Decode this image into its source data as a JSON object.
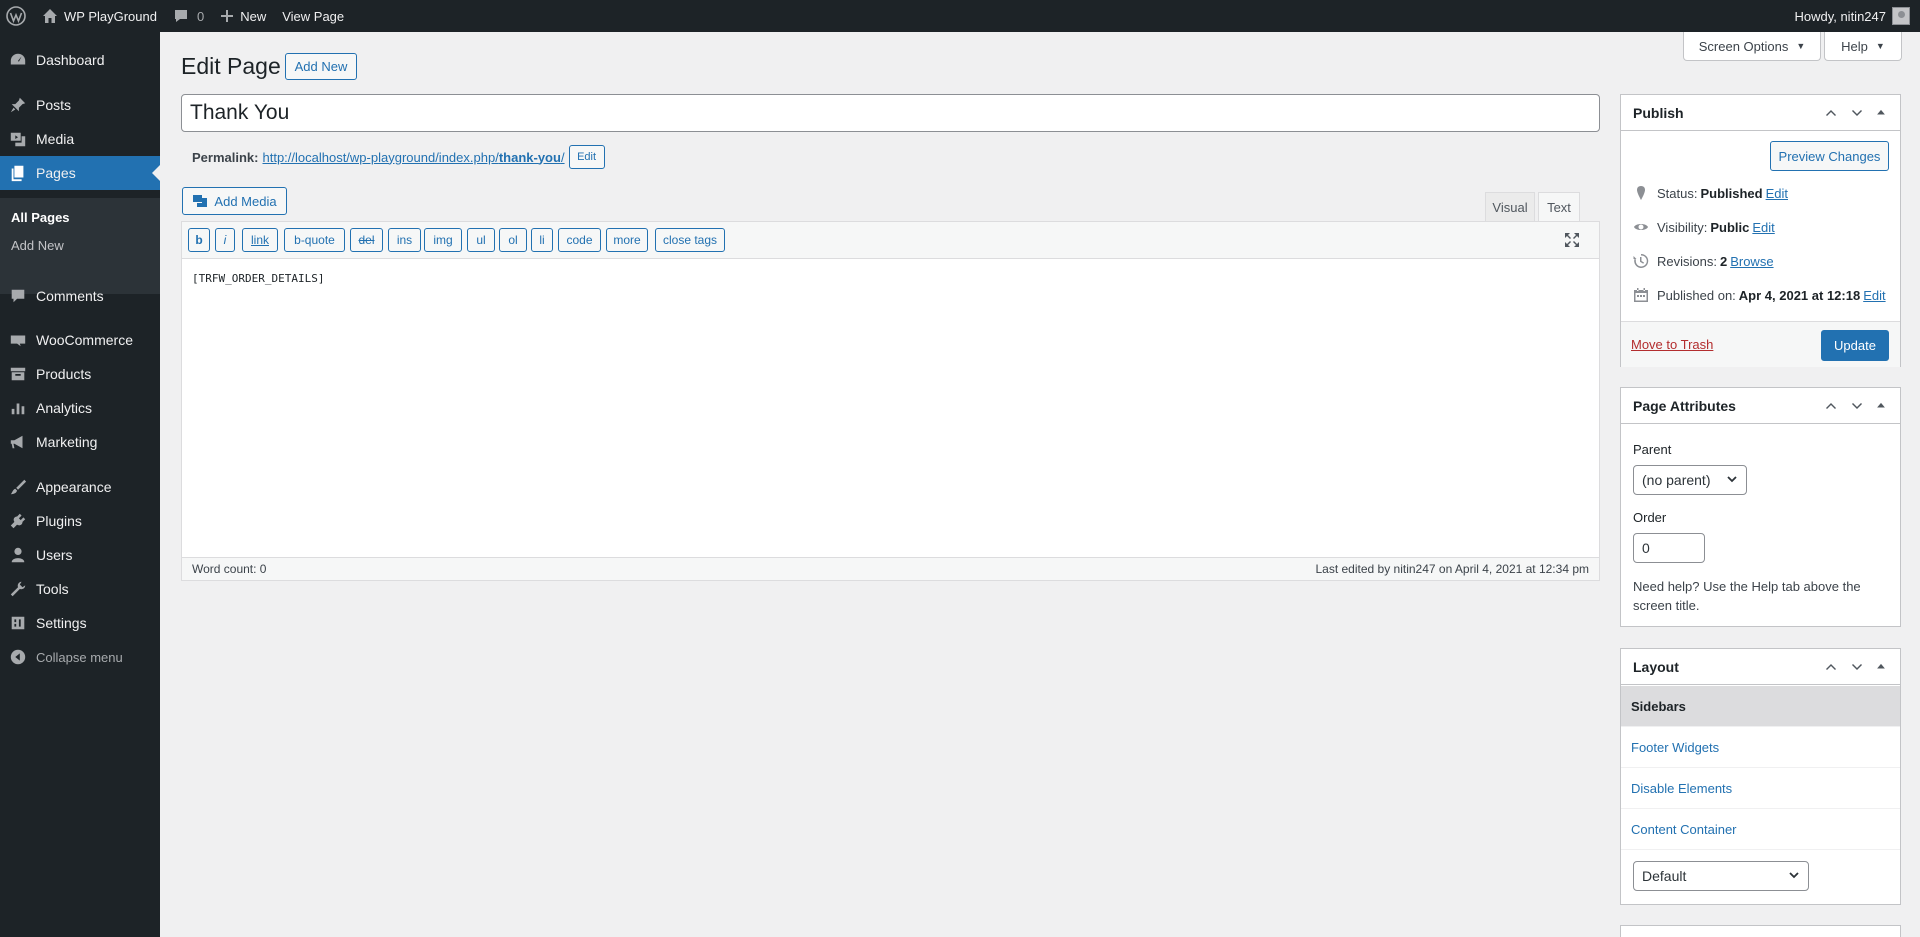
{
  "adminbar": {
    "site_name": "WP PlayGround",
    "comments_count": "0",
    "new_label": "New",
    "view_page": "View Page",
    "howdy": "Howdy, nitin247"
  },
  "sidebar": {
    "items": [
      {
        "label": "Dashboard",
        "icon": "dashboard-icon"
      },
      {
        "label": "Posts",
        "icon": "pin-icon"
      },
      {
        "label": "Media",
        "icon": "media-icon"
      },
      {
        "label": "Pages",
        "icon": "pages-icon"
      },
      {
        "label": "Comments",
        "icon": "comment-icon"
      },
      {
        "label": "WooCommerce",
        "icon": "woo-icon"
      },
      {
        "label": "Products",
        "icon": "archive-icon"
      },
      {
        "label": "Analytics",
        "icon": "chart-icon"
      },
      {
        "label": "Marketing",
        "icon": "megaphone-icon"
      },
      {
        "label": "Appearance",
        "icon": "brush-icon"
      },
      {
        "label": "Plugins",
        "icon": "plug-icon"
      },
      {
        "label": "Users",
        "icon": "user-icon"
      },
      {
        "label": "Tools",
        "icon": "wrench-icon"
      },
      {
        "label": "Settings",
        "icon": "settings-icon"
      }
    ],
    "sub": {
      "all_pages": "All Pages",
      "add_new": "Add New"
    },
    "collapse": "Collapse menu"
  },
  "header": {
    "title": "Edit Page",
    "add_new": "Add New",
    "screen_options": "Screen Options",
    "help": "Help"
  },
  "post": {
    "title": "Thank You",
    "permalink_label": "Permalink:",
    "permalink_base": "http://localhost/wp-playground/index.php/",
    "permalink_slug": "thank-you",
    "permalink_trail": "/",
    "permalink_edit": "Edit"
  },
  "editor": {
    "add_media": "Add Media",
    "tab_visual": "Visual",
    "tab_text": "Text",
    "qt_buttons": [
      "b",
      "i",
      "link",
      "b-quote",
      "del",
      "ins",
      "img",
      "ul",
      "ol",
      "li",
      "code",
      "more",
      "close tags"
    ],
    "content": "[TRFW_ORDER_DETAILS]",
    "word_count": "Word count: 0",
    "last_edited": "Last edited by nitin247 on April 4, 2021 at 12:34 pm"
  },
  "publish": {
    "title": "Publish",
    "preview": "Preview Changes",
    "status_label": "Status:",
    "status_value": "Published",
    "visibility_label": "Visibility:",
    "visibility_value": "Public",
    "revisions_label": "Revisions:",
    "revisions_value": "2",
    "browse": "Browse",
    "published_label": "Published on:",
    "published_value": "Apr 4, 2021 at 12:18",
    "edit": "Edit",
    "trash": "Move to Trash",
    "update": "Update"
  },
  "page_attributes": {
    "title": "Page Attributes",
    "parent_label": "Parent",
    "parent_value": "(no parent)",
    "order_label": "Order",
    "order_value": "0",
    "help_text": "Need help? Use the Help tab above the screen title."
  },
  "layout": {
    "title": "Layout",
    "items": [
      "Sidebars",
      "Footer Widgets",
      "Disable Elements",
      "Content Container"
    ],
    "select_value": "Default"
  }
}
